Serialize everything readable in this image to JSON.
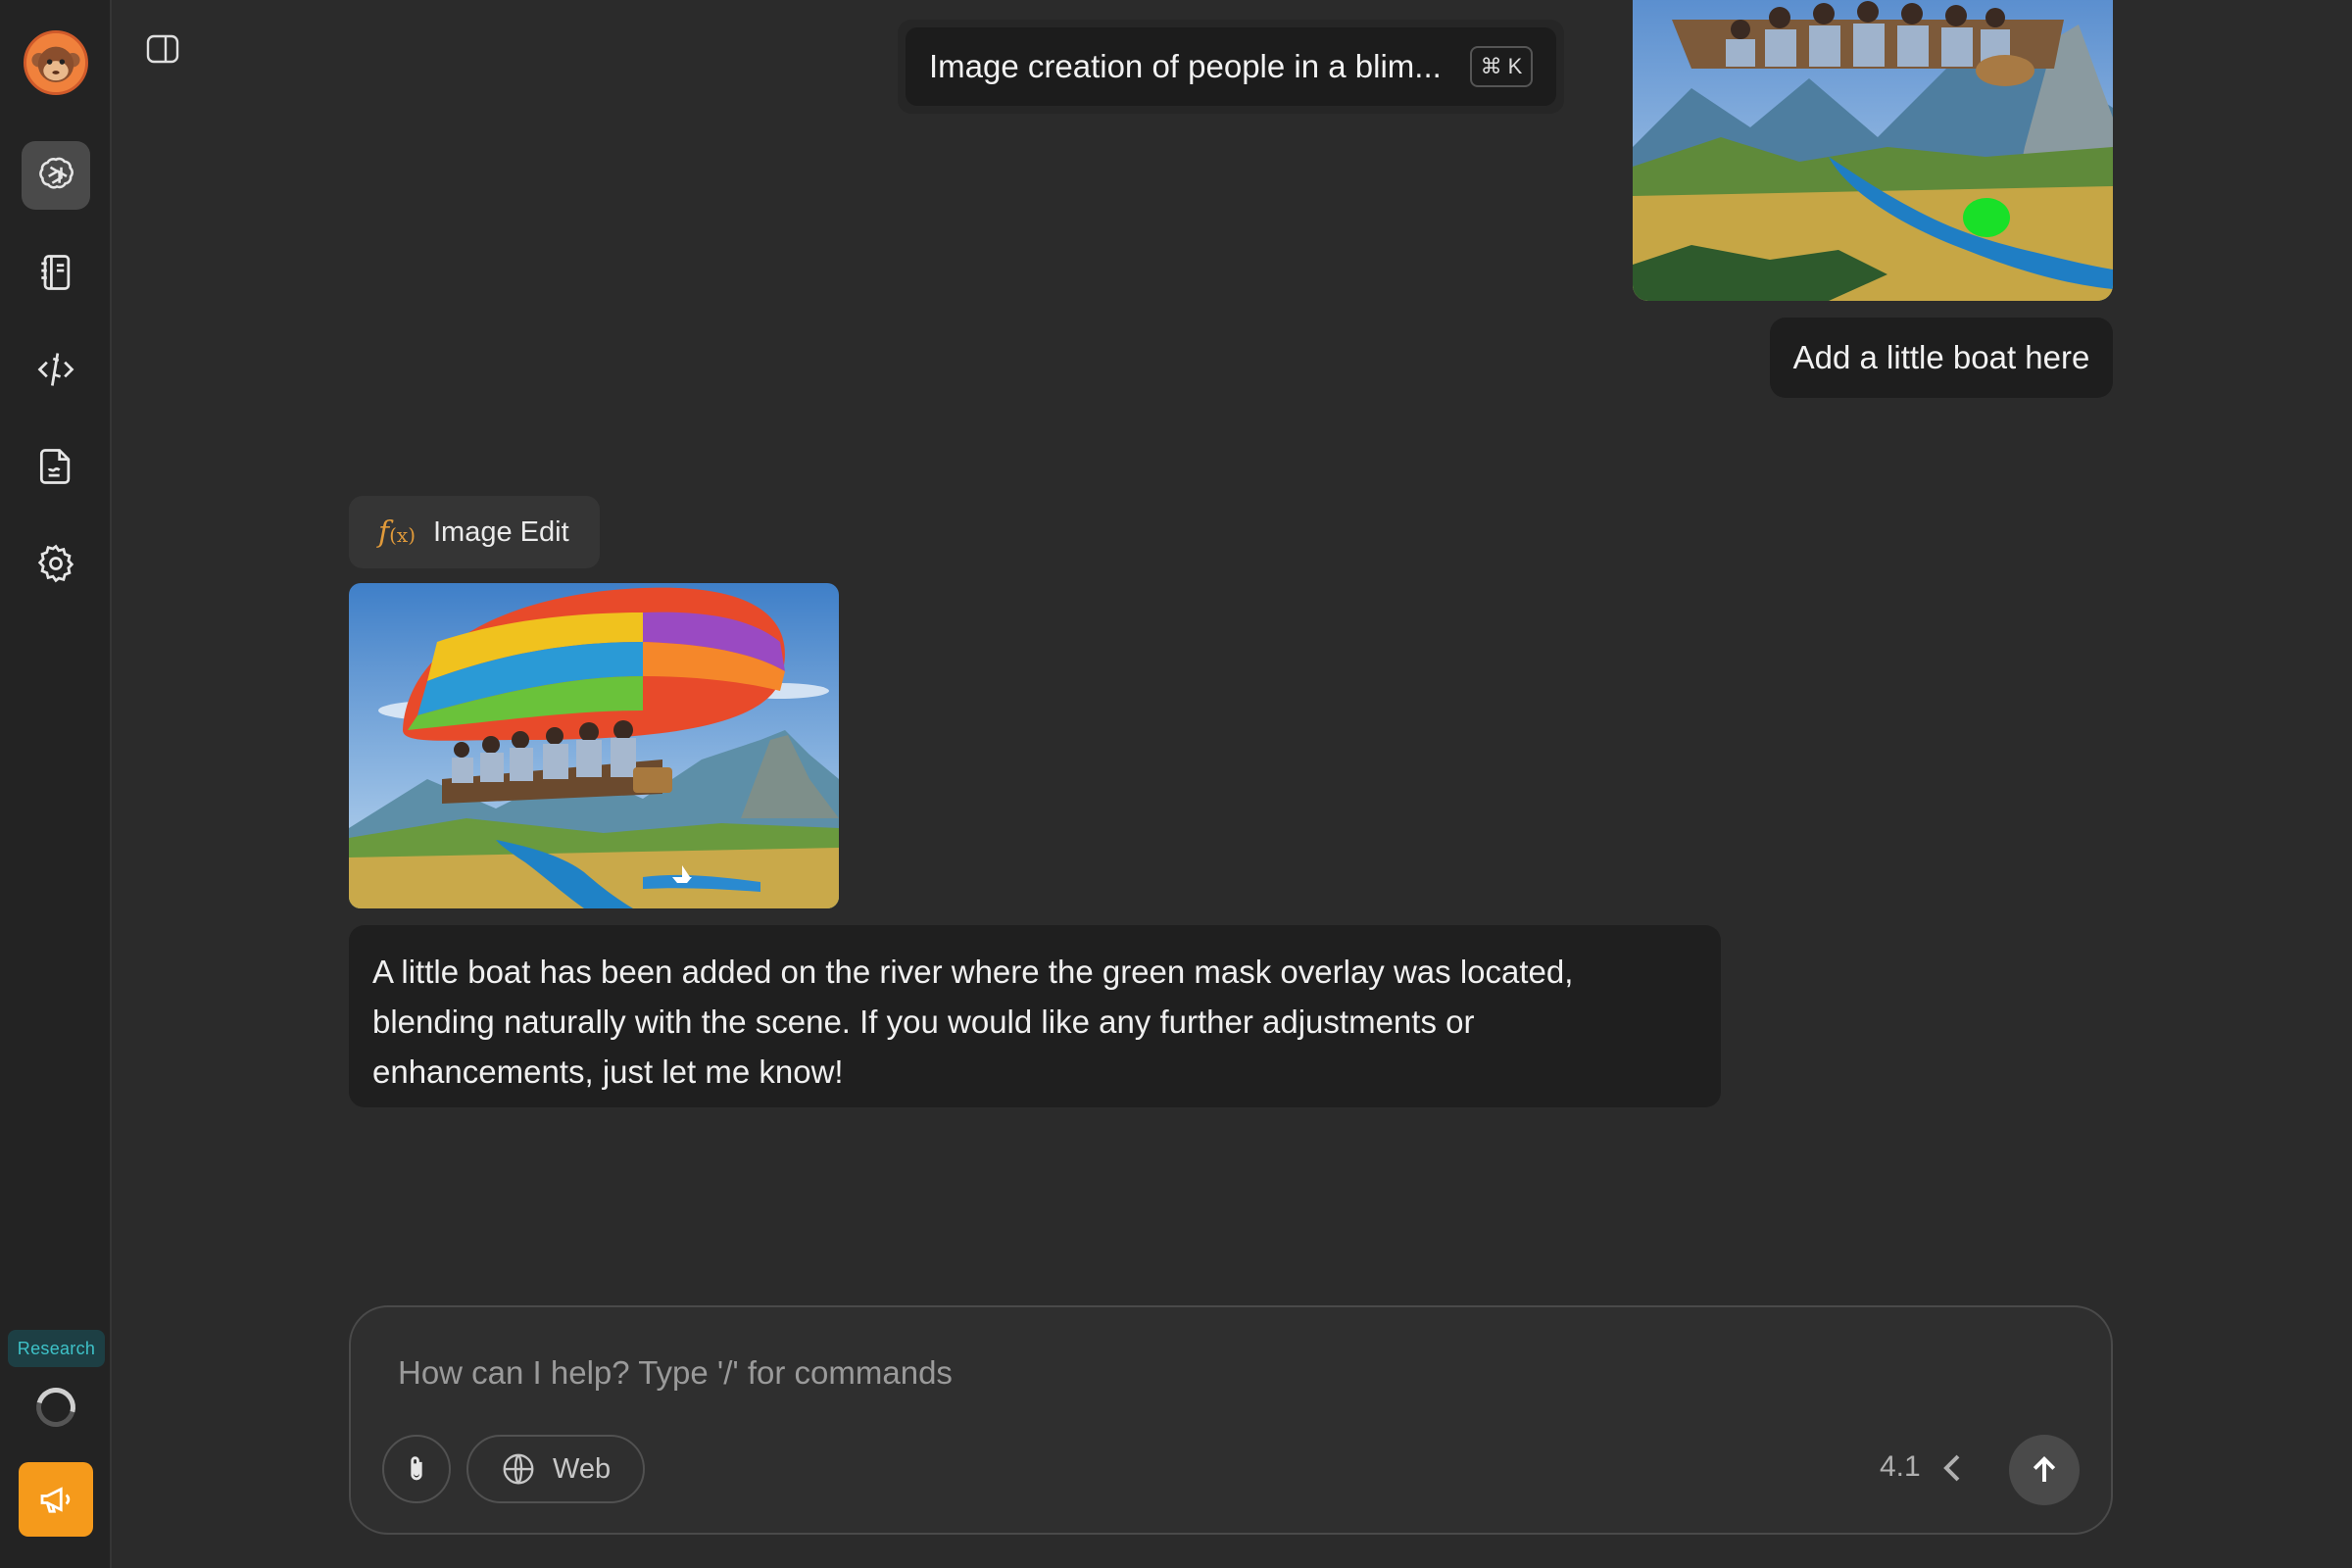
{
  "sidebar": {
    "avatar_icon": "monkey-avatar-icon",
    "items": [
      {
        "icon": "openai-logo-icon",
        "active": true
      },
      {
        "icon": "notebook-icon",
        "active": false
      },
      {
        "icon": "code-pen-icon",
        "active": false
      },
      {
        "icon": "document-icon",
        "active": false
      },
      {
        "icon": "gear-icon",
        "active": false
      }
    ],
    "research_badge": "Research",
    "announce_icon": "megaphone-icon"
  },
  "header": {
    "panel_toggle_icon": "sidebar-toggle-icon"
  },
  "conversation": {
    "title": "Image creation of people in a blim...",
    "shortcut": {
      "symbol": "⌘",
      "key": "K"
    }
  },
  "messages": {
    "user_image_icon": "blimp-landscape-with-green-mask-image",
    "user_text": "Add a little boat here",
    "tool_label": "Image Edit",
    "tool_fx": "f",
    "tool_fx_arg": "(x)",
    "result_image_icon": "blimp-landscape-with-boat-image",
    "reply_text": "A little boat has been added on the river where the green mask overlay was located, blending naturally with the scene. If you would like any further adjustments or enhancements, just let me know!"
  },
  "composer": {
    "placeholder": "How can I help? Type '/' for commands",
    "value": "",
    "attach_icon": "paperclip-icon",
    "web_label": "Web",
    "web_icon": "globe-icon",
    "model_version": "4.1",
    "send_icon": "arrow-up-icon"
  },
  "colors": {
    "background": "#2b2b2b",
    "sidebar": "#232323",
    "accent_orange": "#f59a1b",
    "research_teal": "#3ec2c8"
  }
}
